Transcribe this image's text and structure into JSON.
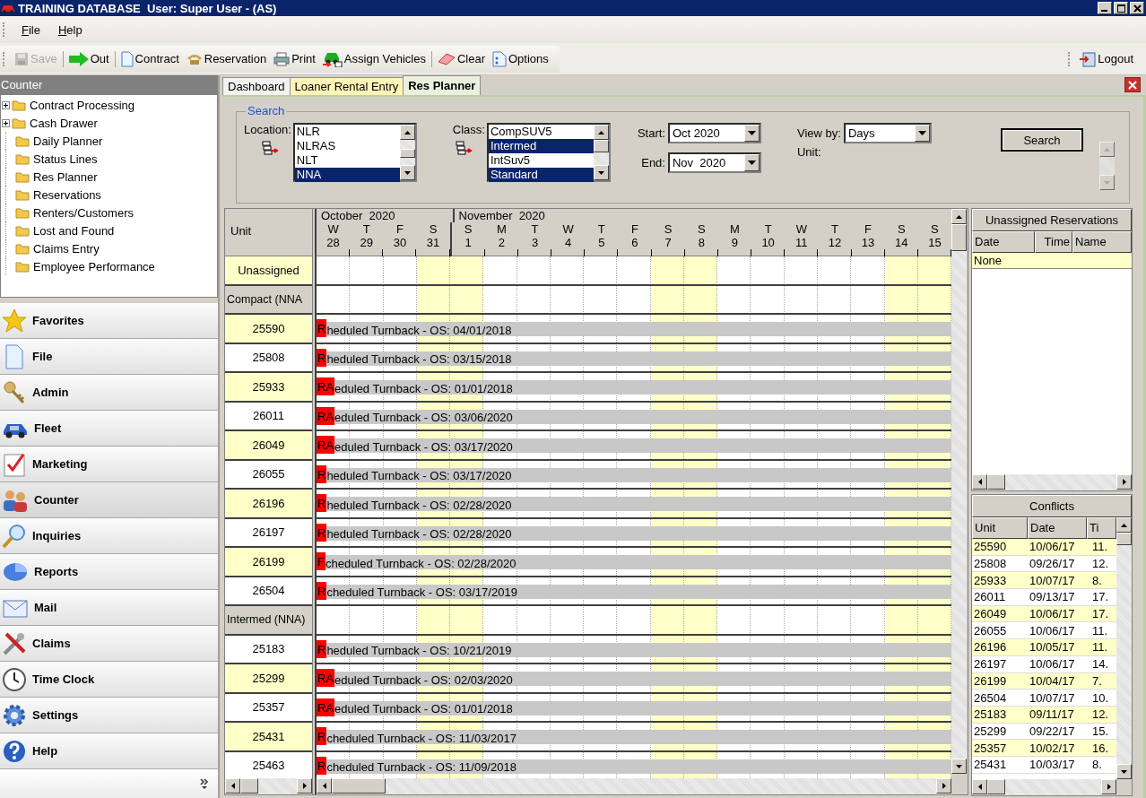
{
  "window": {
    "title": "TRAINING DATABASE  User: Super User - (AS)"
  },
  "menu": [
    {
      "label": "File"
    },
    {
      "label": "Help"
    }
  ],
  "toolbar": {
    "groups": [
      [
        {
          "label": "Save",
          "kind": "save",
          "disabled": true
        }
      ],
      [
        {
          "label": "Out",
          "kind": "out",
          "disabled": false
        }
      ],
      [
        {
          "label": "Contract",
          "kind": "contract",
          "disabled": false
        },
        {
          "label": "Reservation",
          "kind": "reservation",
          "disabled": false
        },
        {
          "label": "Print",
          "kind": "print",
          "disabled": false
        },
        {
          "label": "Assign Vehicles",
          "kind": "assign",
          "disabled": false
        }
      ],
      [
        {
          "label": "Clear",
          "kind": "clear",
          "disabled": false
        },
        {
          "label": "Options",
          "kind": "options",
          "disabled": false
        }
      ]
    ],
    "logout": "Logout"
  },
  "sidebar": {
    "title": "Counter",
    "tree": [
      {
        "label": "Contract Processing",
        "expanded": false
      },
      {
        "label": "Cash Drawer",
        "expanded": false
      },
      {
        "label": "Daily Planner"
      },
      {
        "label": "Status Lines"
      },
      {
        "label": "Res Planner"
      },
      {
        "label": "Reservations"
      },
      {
        "label": "Renters/Customers"
      },
      {
        "label": "Lost and Found"
      },
      {
        "label": "Claims Entry"
      },
      {
        "label": "Employee Performance"
      }
    ],
    "nav": [
      {
        "label": "Favorites",
        "kind": "star",
        "selected": false
      },
      {
        "label": "File",
        "kind": "file",
        "selected": false
      },
      {
        "label": "Admin",
        "kind": "keys",
        "selected": false
      },
      {
        "label": "Fleet",
        "kind": "car",
        "selected": false
      },
      {
        "label": "Marketing",
        "kind": "checklist",
        "selected": false
      },
      {
        "label": "Counter",
        "kind": "people",
        "selected": true
      },
      {
        "label": "Inquiries",
        "kind": "magnifier",
        "selected": false
      },
      {
        "label": "Reports",
        "kind": "pie",
        "selected": false
      },
      {
        "label": "Mail",
        "kind": "mail",
        "selected": false
      },
      {
        "label": "Claims",
        "kind": "tools",
        "selected": false
      },
      {
        "label": "Time Clock",
        "kind": "clock",
        "selected": false
      },
      {
        "label": "Settings",
        "kind": "gear",
        "selected": false
      },
      {
        "label": "Help",
        "kind": "help",
        "selected": false
      }
    ]
  },
  "tabs": [
    {
      "label": "Dashboard",
      "selected": false,
      "highlight": false
    },
    {
      "label": "Loaner Rental Entry",
      "selected": false,
      "highlight": true
    },
    {
      "label": "Res Planner",
      "selected": true,
      "highlight": false
    }
  ],
  "search": {
    "title": "Search",
    "location": {
      "label": "Location:",
      "items": [
        {
          "label": "NLR",
          "selected": false
        },
        {
          "label": "NLRAS",
          "selected": false
        },
        {
          "label": "NLT",
          "selected": false
        },
        {
          "label": "NNA",
          "selected": true
        }
      ]
    },
    "class": {
      "label": "Class:",
      "items": [
        {
          "label": "CompSUV5",
          "selected": false
        },
        {
          "label": "Intermed",
          "selected": true
        },
        {
          "label": "IntSuv5",
          "selected": false
        },
        {
          "label": "Standard",
          "selected": true
        }
      ]
    },
    "start": {
      "label": "Start:",
      "value": "Oct 2020"
    },
    "end": {
      "label": "End:",
      "value": "Nov  2020"
    },
    "view_by": {
      "label": "View by:",
      "value": "Days"
    },
    "unit": {
      "label": "Unit:"
    },
    "button": "Search"
  },
  "planner": {
    "unit_header": "Unit",
    "days": [
      {
        "dow": "W",
        "day": "28",
        "weekend": false,
        "month": "October  2020"
      },
      {
        "dow": "T",
        "day": "29",
        "weekend": false
      },
      {
        "dow": "F",
        "day": "30",
        "weekend": false
      },
      {
        "dow": "S",
        "day": "31",
        "weekend": true
      },
      {
        "dow": "S",
        "day": "1",
        "weekend": true,
        "month": "November  2020"
      },
      {
        "dow": "M",
        "day": "2",
        "weekend": false
      },
      {
        "dow": "T",
        "day": "3",
        "weekend": false
      },
      {
        "dow": "W",
        "day": "4",
        "weekend": false
      },
      {
        "dow": "T",
        "day": "5",
        "weekend": false
      },
      {
        "dow": "F",
        "day": "6",
        "weekend": false
      },
      {
        "dow": "S",
        "day": "7",
        "weekend": true
      },
      {
        "dow": "S",
        "day": "8",
        "weekend": true
      },
      {
        "dow": "M",
        "day": "9",
        "weekend": false
      },
      {
        "dow": "T",
        "day": "10",
        "weekend": false
      },
      {
        "dow": "W",
        "day": "11",
        "weekend": false
      },
      {
        "dow": "T",
        "day": "12",
        "weekend": false
      },
      {
        "dow": "F",
        "day": "13",
        "weekend": false
      },
      {
        "dow": "S",
        "day": "14",
        "weekend": true
      },
      {
        "dow": "S",
        "day": "15",
        "weekend": true
      }
    ],
    "rows": [
      {
        "kind": "unassigned",
        "unit": "Unassigned"
      },
      {
        "kind": "group",
        "unit": "Compact (NNA"
      },
      {
        "kind": "unit",
        "unit": "25590",
        "shaded": true,
        "tag": "R",
        "label": "heduled Turnback - OS: 04/01/2018"
      },
      {
        "kind": "unit",
        "unit": "25808",
        "shaded": false,
        "tag": "R",
        "label": "heduled Turnback - OS: 03/15/2018"
      },
      {
        "kind": "unit",
        "unit": "25933",
        "shaded": true,
        "tag": "RA",
        "label": "eduled Turnback - OS: 01/01/2018"
      },
      {
        "kind": "unit",
        "unit": "26011",
        "shaded": false,
        "tag": "RA",
        "label": "eduled Turnback - OS: 03/06/2020"
      },
      {
        "kind": "unit",
        "unit": "26049",
        "shaded": true,
        "tag": "RA",
        "label": "eduled Turnback - OS: 03/17/2020"
      },
      {
        "kind": "unit",
        "unit": "26055",
        "shaded": false,
        "tag": "R",
        "label": "heduled Turnback - OS: 03/17/2020"
      },
      {
        "kind": "unit",
        "unit": "26196",
        "shaded": true,
        "tag": "R",
        "label": "heduled Turnback - OS: 02/28/2020"
      },
      {
        "kind": "unit",
        "unit": "26197",
        "shaded": false,
        "tag": "R",
        "label": "heduled Turnback - OS: 02/28/2020"
      },
      {
        "kind": "unit",
        "unit": "26199",
        "shaded": true,
        "tag": "F",
        "label": "cheduled Turnback - OS: 02/28/2020"
      },
      {
        "kind": "unit",
        "unit": "26504",
        "shaded": false,
        "tag": "R",
        "label": "cheduled Turnback - OS: 03/17/2019"
      },
      {
        "kind": "group",
        "unit": "Intermed (NNA)"
      },
      {
        "kind": "unit",
        "unit": "25183",
        "shaded": false,
        "tag": "R",
        "label": "heduled Turnback - OS: 10/21/2019"
      },
      {
        "kind": "unit",
        "unit": "25299",
        "shaded": true,
        "tag": "RA",
        "label": "eduled Turnback - OS: 02/03/2020"
      },
      {
        "kind": "unit",
        "unit": "25357",
        "shaded": false,
        "tag": "RA",
        "label": "eduled Turnback - OS: 01/01/2018"
      },
      {
        "kind": "unit",
        "unit": "25431",
        "shaded": true,
        "tag": "R",
        "label": "cheduled Turnback - OS: 11/03/2017"
      },
      {
        "kind": "unit",
        "unit": "25463",
        "shaded": false,
        "tag": "R",
        "label": "cheduled Turnback - OS: 11/09/2018"
      }
    ]
  },
  "unassigned": {
    "title": "Unassigned Reservations",
    "columns": [
      "Date",
      "Time",
      "Name"
    ],
    "rows": [
      {
        "text": "None",
        "shaded": true
      }
    ]
  },
  "conflicts": {
    "title": "Conflicts",
    "columns": [
      "Unit",
      "Date",
      "Ti"
    ],
    "rows": [
      {
        "unit": "25590",
        "date": "10/06/17",
        "time": "11.",
        "shaded": true
      },
      {
        "unit": "25808",
        "date": "09/26/17",
        "time": "12.",
        "shaded": false
      },
      {
        "unit": "25933",
        "date": "10/07/17",
        "time": "8.",
        "shaded": true
      },
      {
        "unit": "26011",
        "date": "09/13/17",
        "time": "17.",
        "shaded": false
      },
      {
        "unit": "26049",
        "date": "10/06/17",
        "time": "17.",
        "shaded": true
      },
      {
        "unit": "26055",
        "date": "10/06/17",
        "time": "11.",
        "shaded": false
      },
      {
        "unit": "26196",
        "date": "10/05/17",
        "time": "11.",
        "shaded": true
      },
      {
        "unit": "26197",
        "date": "10/06/17",
        "time": "14.",
        "shaded": false
      },
      {
        "unit": "26199",
        "date": "10/04/17",
        "time": "7.",
        "shaded": true
      },
      {
        "unit": "26504",
        "date": "10/07/17",
        "time": "10.",
        "shaded": false
      },
      {
        "unit": "25183",
        "date": "09/11/17",
        "time": "12.",
        "shaded": true
      },
      {
        "unit": "25299",
        "date": "09/22/17",
        "time": "15.",
        "shaded": false
      },
      {
        "unit": "25357",
        "date": "10/02/17",
        "time": "16.",
        "shaded": true
      },
      {
        "unit": "25431",
        "date": "10/03/17",
        "time": "8.",
        "shaded": false
      }
    ]
  }
}
